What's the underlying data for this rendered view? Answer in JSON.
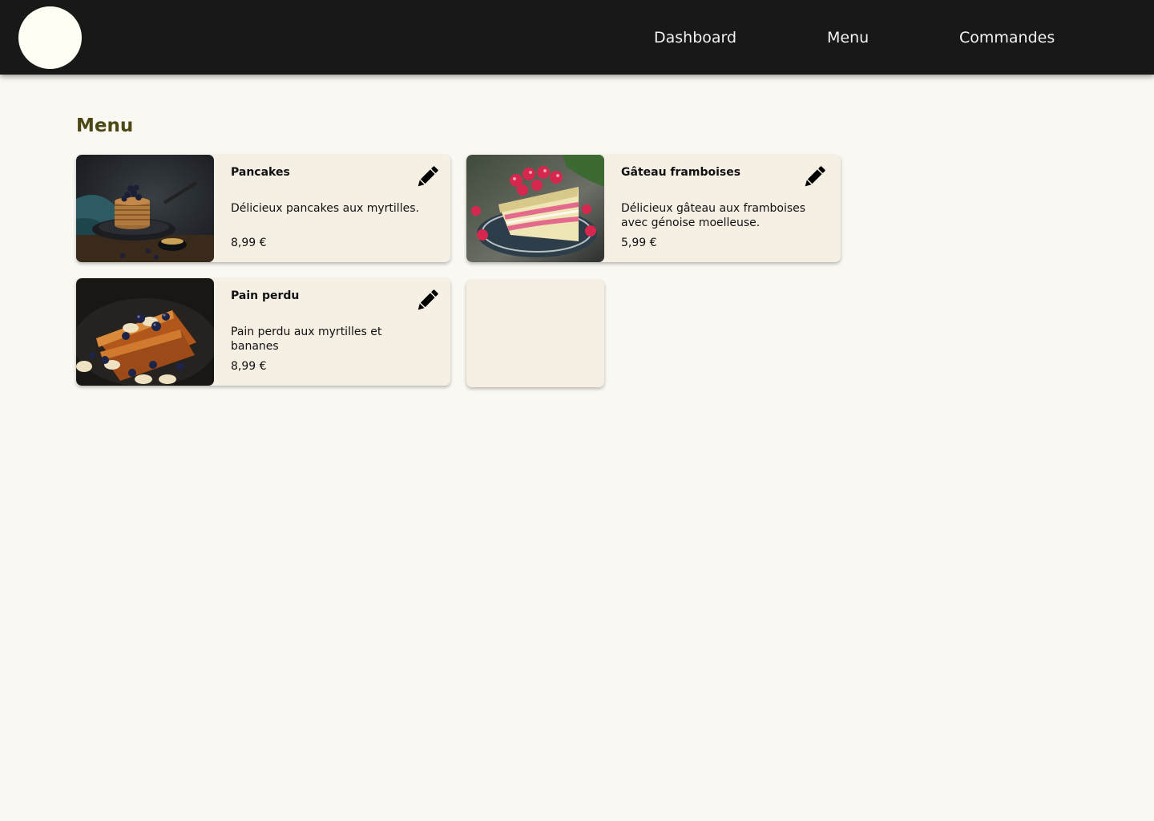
{
  "nav": {
    "items": [
      {
        "label": "Dashboard"
      },
      {
        "label": "Menu"
      },
      {
        "label": "Commandes"
      }
    ]
  },
  "main": {
    "title": "Menu",
    "items": [
      {
        "name": "Pancakes",
        "description": "Délicieux pancakes aux myrtilles.",
        "price": "8,99 €",
        "image_icon": "pancakes-photo"
      },
      {
        "name": "Gâteau framboises",
        "description": "Délicieux gâteau aux framboises avec génoise moelleuse.",
        "price": "5,99 €",
        "image_icon": "raspberry-cake-photo"
      },
      {
        "name": "Pain perdu",
        "description": "Pain perdu aux myrtilles et bananes",
        "price": "8,99 €",
        "image_icon": "french-toast-photo"
      }
    ],
    "edit_icon": "pencil-icon"
  },
  "colors": {
    "topbar": "#181818",
    "background": "#faf8f3",
    "card": "#f6efe4",
    "title": "#4b4816"
  }
}
